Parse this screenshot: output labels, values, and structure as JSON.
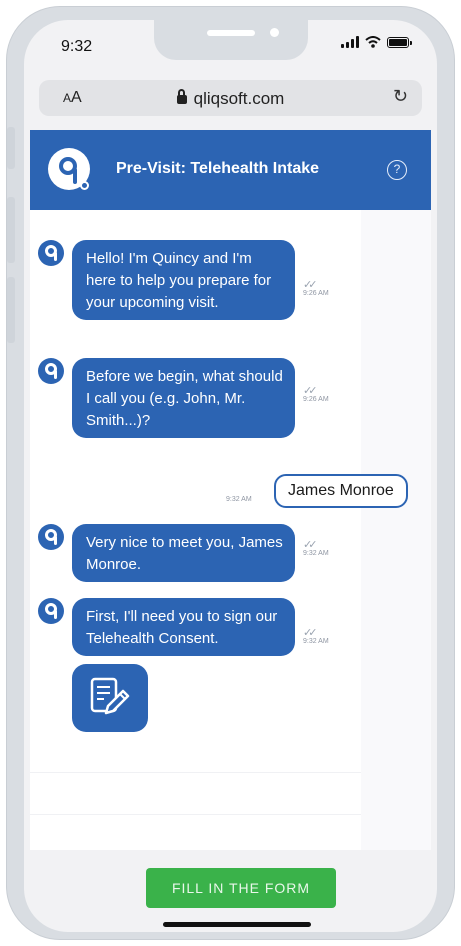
{
  "status_bar": {
    "time": "9:32"
  },
  "browser": {
    "text_size_label_small": "A",
    "text_size_label_large": "A",
    "url": "qliqsoft.com"
  },
  "header": {
    "title": "Pre-Visit: Telehealth Intake",
    "help_glyph": "?"
  },
  "messages": [
    {
      "sender": "bot",
      "text": "Hello! I'm Quincy and I'm here to help you prepare for your upcoming visit.",
      "time": "9:26 AM"
    },
    {
      "sender": "bot",
      "text": "Before we begin, what should I call you (e.g. John, Mr. Smith...)?",
      "time": "9:26 AM"
    },
    {
      "sender": "user",
      "text": "James Monroe",
      "time": "9:32 AM"
    },
    {
      "sender": "bot",
      "text": "Very nice to meet you, James Monroe.",
      "time": "9:32 AM"
    },
    {
      "sender": "bot",
      "text": "First, I'll need you to sign our Telehealth Consent.",
      "time": "9:32 AM"
    }
  ],
  "fill_button_label": "FILL IN THE FORM",
  "colors": {
    "brand_blue": "#2c64b3",
    "button_green": "#3ab24a"
  },
  "icons": [
    "signal-icon",
    "wifi-icon",
    "battery-icon",
    "lock-icon",
    "reload-icon",
    "help-icon",
    "form-edit-icon",
    "read-receipt-icon"
  ]
}
